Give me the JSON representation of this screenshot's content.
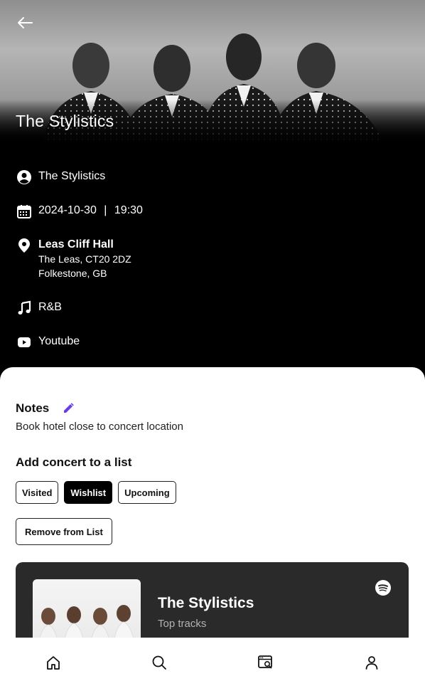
{
  "hero": {
    "title": "The Stylistics"
  },
  "details": {
    "artist": "The Stylistics",
    "date": "2024-10-30",
    "separator": "|",
    "time": "19:30",
    "venue": {
      "name": "Leas Cliff Hall",
      "address": "The Leas, CT20 2DZ",
      "city": "Folkestone, GB"
    },
    "genre": "R&B",
    "video_source": "Youtube"
  },
  "notes": {
    "title": "Notes",
    "text": "Book hotel close to concert location"
  },
  "lists": {
    "title": "Add concert to a list",
    "options": [
      "Visited",
      "Wishlist",
      "Upcoming"
    ],
    "selected": "Wishlist",
    "remove_label": "Remove from List"
  },
  "spotify": {
    "title": "The Stylistics",
    "subtitle": "Top tracks"
  },
  "nav": {
    "items": [
      "home-icon",
      "search-icon",
      "browse-icon",
      "profile-icon"
    ]
  },
  "colors": {
    "accent": "#6a3ee6",
    "background": "#000000",
    "panel": "#ffffff",
    "spotify_card": "#2a2a2a"
  }
}
